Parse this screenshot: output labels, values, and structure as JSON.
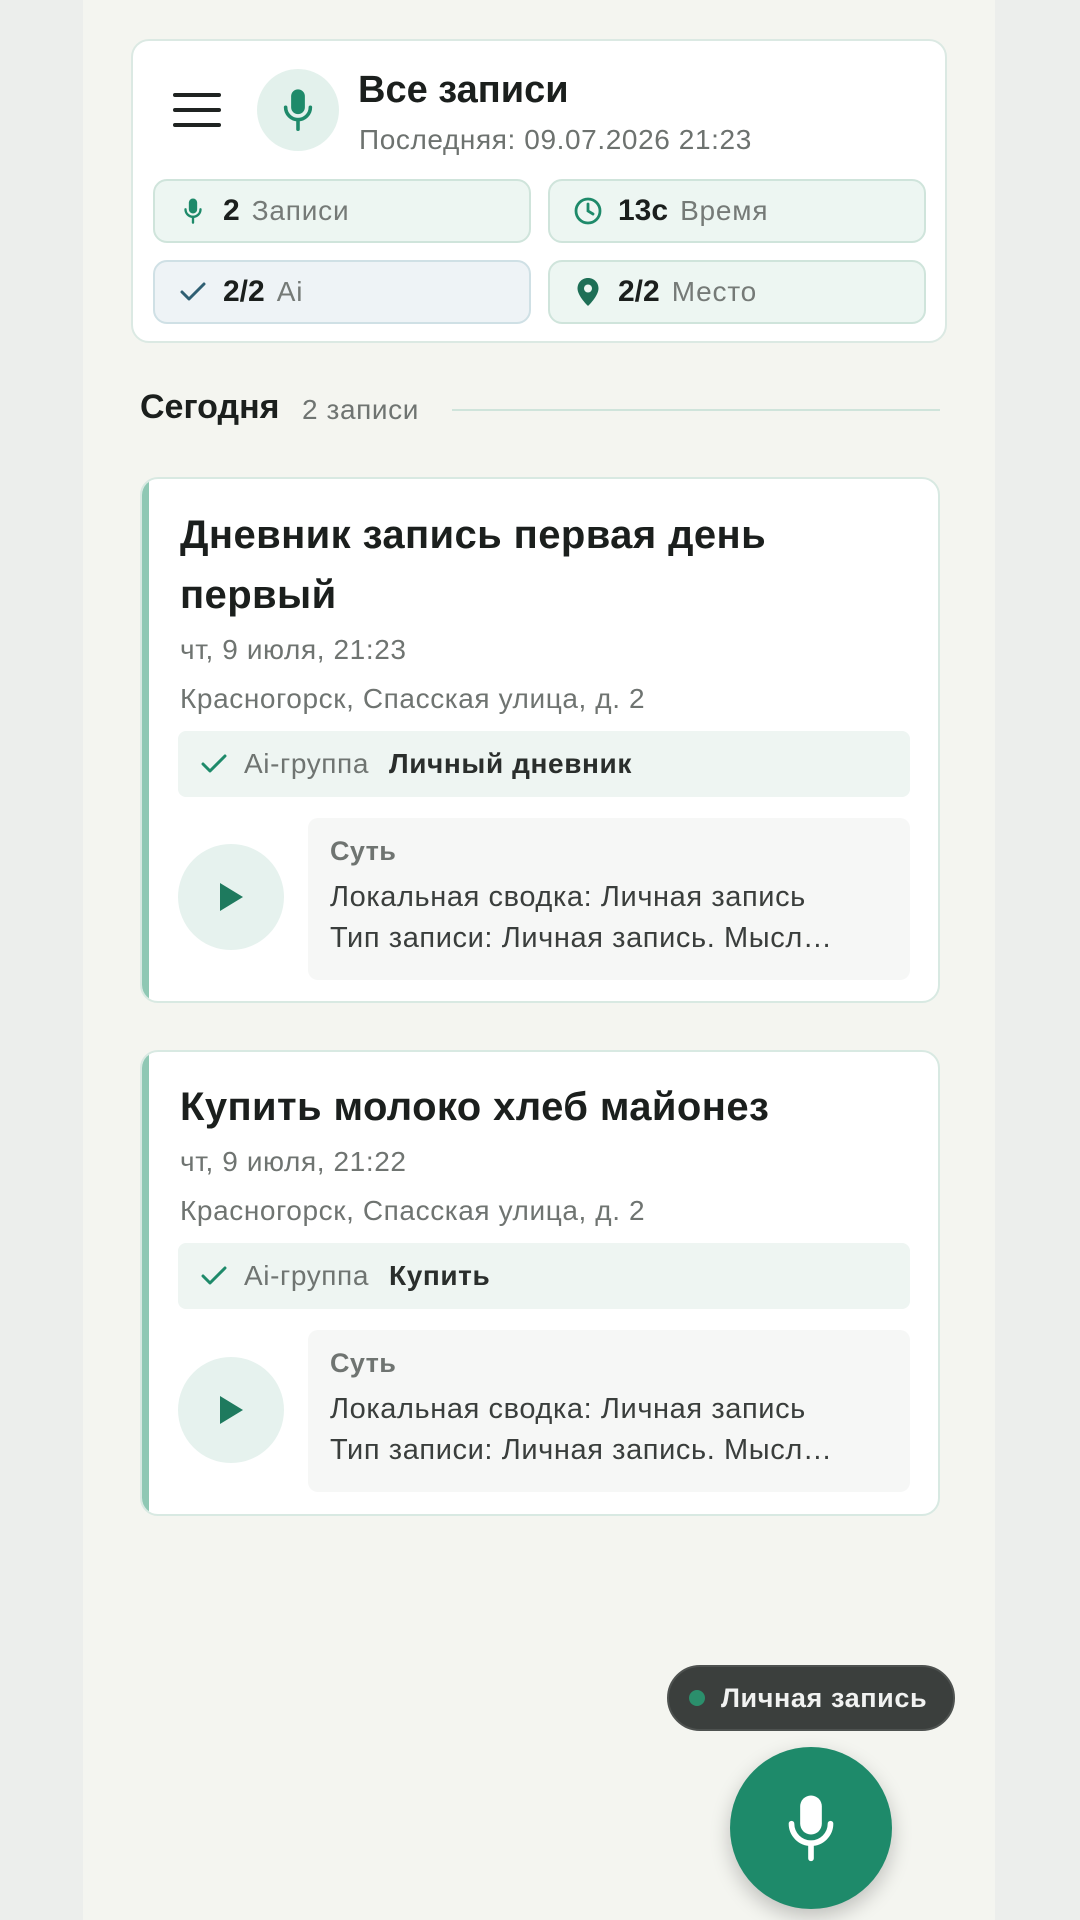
{
  "header": {
    "title": "Все записи",
    "subtitle": "Последняя: 09.07.2026 21:23",
    "stats": [
      {
        "icon": "mic-icon",
        "value": "2",
        "label": "Записи"
      },
      {
        "icon": "clock-icon",
        "value": "13с",
        "label": "Время"
      },
      {
        "icon": "check-icon",
        "value": "2/2",
        "label": "Ai"
      },
      {
        "icon": "location-pin-icon",
        "value": "2/2",
        "label": "Место"
      }
    ]
  },
  "section": {
    "title": "Сегодня",
    "count": "2 записи"
  },
  "entries": [
    {
      "title": "Дневник запись первая день первый",
      "date": "чт, 9 июля, 21:23",
      "location": "Красногорск, Спасская улица, д. 2",
      "group_label": "Ai-группа",
      "group_value": "Личный дневник",
      "summary_label": "Суть",
      "summary_text": "Локальная сводка: Личная запись\nТип записи: Личная запись. Мысл…"
    },
    {
      "title": "Купить молоко хлеб майонез",
      "date": "чт, 9 июля, 21:22",
      "location": "Красногорск, Спасская улица, д. 2",
      "group_label": "Ai-группа",
      "group_value": "Купить",
      "summary_label": "Суть",
      "summary_text": "Локальная сводка: Личная запись\nТип записи: Личная запись. Мысл…"
    }
  ],
  "toast": {
    "label": "Личная запись"
  },
  "colors": {
    "accent": "#1e8a6a",
    "accent_light": "#e3f1ec",
    "card_border": "#d8e9e2",
    "entry_stripe": "#8fc8b4"
  }
}
